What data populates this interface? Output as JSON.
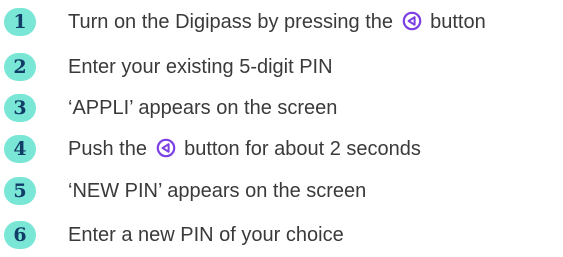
{
  "steps": [
    {
      "number": "1",
      "text_before": "Turn on the Digipass by pressing the",
      "icon": "back-triangle-circle-icon",
      "text_after": "button"
    },
    {
      "number": "2",
      "text": "Enter your existing 5-digit PIN"
    },
    {
      "number": "3",
      "text": "‘APPLI’ appears on the screen"
    },
    {
      "number": "4",
      "text_before": "Push the",
      "icon": "back-triangle-circle-icon",
      "text_after": "button for about 2 seconds"
    },
    {
      "number": "5",
      "text": "‘NEW PIN’ appears on the screen"
    },
    {
      "number": "6",
      "text": "Enter a new PIN of your choice"
    }
  ],
  "colors": {
    "badge_background": "#79e6d6",
    "badge_number": "#123c68",
    "icon": "#7b3fe4",
    "text": "#3a3a3a"
  }
}
